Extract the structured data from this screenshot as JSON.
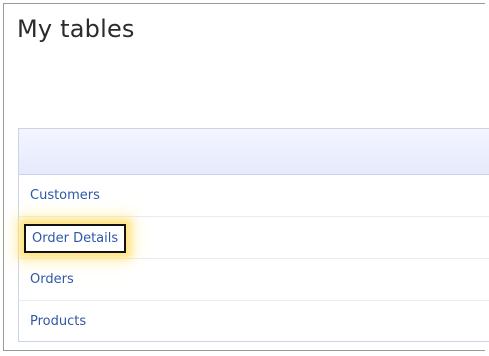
{
  "header": {
    "title": "My tables"
  },
  "tables": {
    "rows": [
      {
        "label": "Customers",
        "highlighted": false
      },
      {
        "label": "Order Details",
        "highlighted": true
      },
      {
        "label": "Orders",
        "highlighted": false
      },
      {
        "label": "Products",
        "highlighted": false
      }
    ]
  },
  "colors": {
    "link": "#2f57a8",
    "header_band": "#e6eafb",
    "highlight_glow": "#ffe078"
  }
}
